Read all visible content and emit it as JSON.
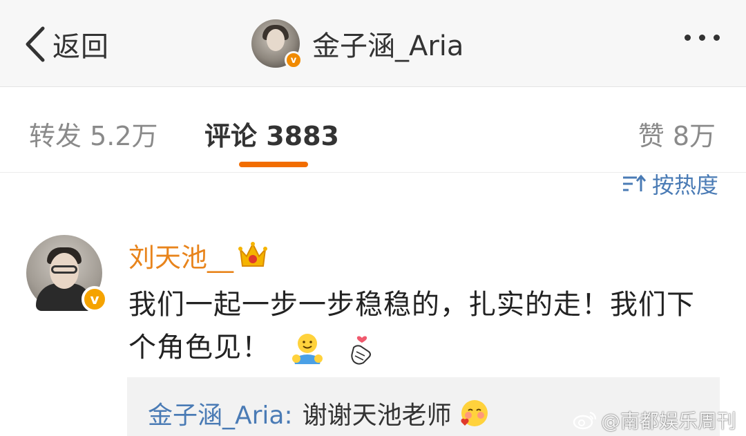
{
  "header": {
    "back_label": "返回",
    "title": "金子涵_Aria",
    "verified_badge": "v",
    "more_icon": "ellipsis-icon"
  },
  "tabs": [
    {
      "label": "转发 5.2万"
    },
    {
      "label": "评论 3883",
      "active": true
    },
    {
      "label": "赞 8万"
    }
  ],
  "sort": {
    "label": "按热度",
    "icon": "sort-icon"
  },
  "comment": {
    "author": "刘天池__",
    "verified_badge": "v",
    "text": "我们一起一步一步稳稳的，扎实的走！我们下个角色见！",
    "emojis": [
      "hug-emoji",
      "finger-heart-emoji"
    ]
  },
  "reply": {
    "author": "金子涵_Aria:",
    "text": "谢谢天池老师"
  },
  "watermark": {
    "text": "@南都娱乐周刊"
  },
  "colors": {
    "accent": "#f26d00",
    "link": "#4a7bb5",
    "name": "#e8841c",
    "header_bg": "#f7f7f7",
    "reply_bg": "#f2f2f2"
  }
}
